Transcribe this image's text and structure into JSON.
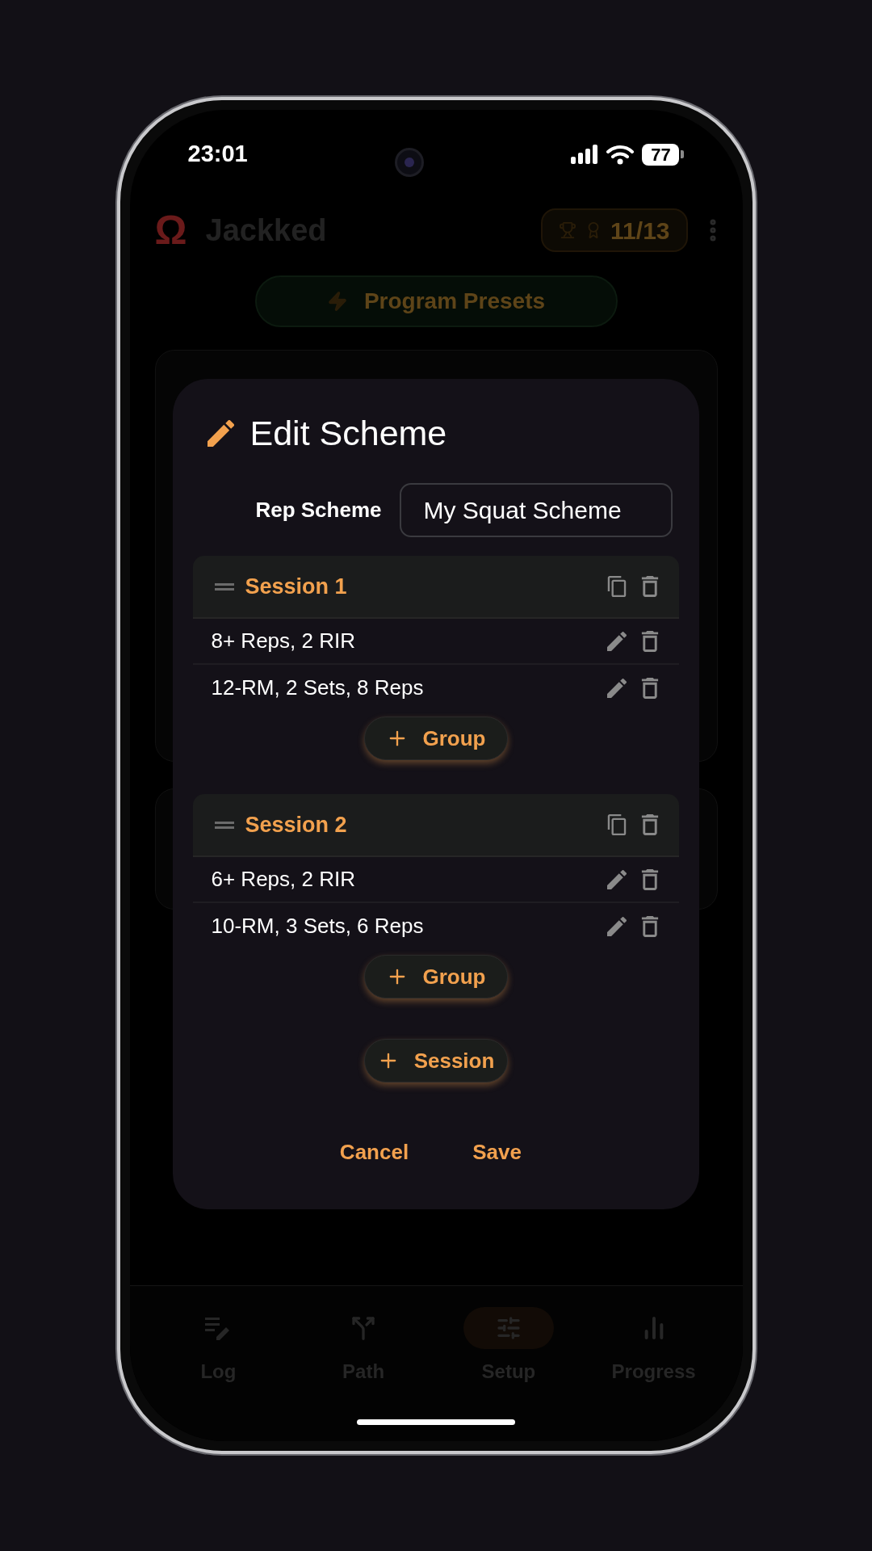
{
  "status_bar": {
    "time": "23:01",
    "battery": "77"
  },
  "app_bar": {
    "logo": "Ω",
    "title": "Jackked",
    "badge": "11/13"
  },
  "presets_button": "Program Presets",
  "dialog": {
    "title": "Edit Scheme",
    "field_label": "Rep Scheme",
    "field_value": "My Squat Scheme",
    "sessions": [
      {
        "title": "Session 1",
        "groups": [
          "8+ Reps, 2 RIR",
          "12-RM, 2 Sets, 8 Reps"
        ],
        "add_group": "Group"
      },
      {
        "title": "Session 2",
        "groups": [
          "6+ Reps, 2 RIR",
          "10-RM, 3 Sets, 6 Reps"
        ],
        "add_group": "Group"
      }
    ],
    "add_session": "Session",
    "buttons": [
      "Cancel",
      "Save"
    ]
  },
  "nav": [
    {
      "label": "Log",
      "selected": false
    },
    {
      "label": "Path",
      "selected": false
    },
    {
      "label": "Setup",
      "selected": true
    },
    {
      "label": "Progress",
      "selected": false
    }
  ]
}
